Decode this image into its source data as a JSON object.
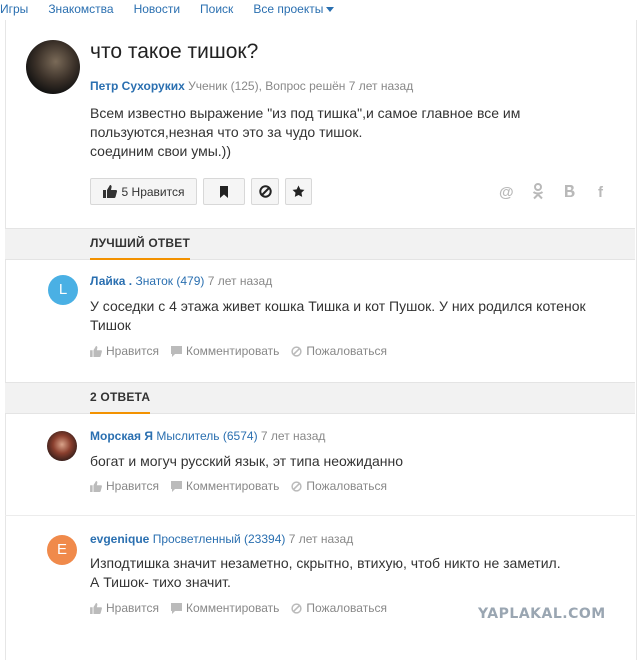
{
  "topnav": {
    "items": [
      "Игры",
      "Знакомства",
      "Новости",
      "Поиск",
      "Все проекты"
    ]
  },
  "question": {
    "title": "что такое тишок?",
    "author": "Петр Сухоруких",
    "meta": "Ученик (125), Вопрос решён 7 лет назад",
    "text": "Всем известно выражение \"из под тишка\",и самое главное все им\nпользуются,незная что это за чудо тишок.\nсоединим свои умы.))",
    "like_label": "5 Нравится"
  },
  "share_icons": [
    "@",
    "ok-icon",
    "vk-icon",
    "f"
  ],
  "best_section": {
    "label": "ЛУЧШИЙ ОТВЕТ"
  },
  "best_answer": {
    "avatar_letter": "L",
    "avatar_color": "#4ab0e4",
    "author": "Лайка .",
    "rank": "Знаток (479)",
    "time": "7 лет назад",
    "text": "У соседки с 4 этажа живет кошка Тишка и кот Пушок. У них родился котенок\nТишок"
  },
  "answers_section": {
    "label": "2 ОТВЕТА"
  },
  "answers": [
    {
      "author": "Морская Я",
      "rank": "Мыслитель (6574)",
      "time": "7 лет назад",
      "text": "богат и могуч русский язык, эт типа неожиданно",
      "avatar_letter": "",
      "avatar_color": "#6b3a2e"
    },
    {
      "author": "evgenique",
      "rank": "Просветленный (23394)",
      "time": "7 лет назад",
      "text": "Изподтишка значит незаметно, скрытно, втихую, чтоб никто не заметил.\nА Тишок- тихо значит.",
      "avatar_letter": "E",
      "avatar_color": "#f08a4b"
    }
  ],
  "actions": {
    "like": "Нравится",
    "comment": "Комментировать",
    "report": "Пожаловаться"
  },
  "watermark": "YAPLAKAL.COM",
  "colors": {
    "link": "#2a6fb0",
    "accent": "#f39200"
  }
}
